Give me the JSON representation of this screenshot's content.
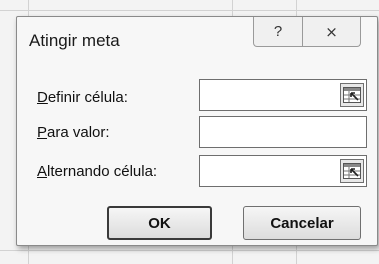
{
  "dialog": {
    "title": "Atingir meta",
    "help_glyph": "?",
    "close_glyph": "⨯"
  },
  "fields": [
    {
      "label_first": "D",
      "label_rest": "efinir célula:",
      "value": ""
    },
    {
      "label_first": "P",
      "label_rest": "ara valor:",
      "value": ""
    },
    {
      "label_first": "A",
      "label_rest": "lternando célula:",
      "value": ""
    }
  ],
  "buttons": {
    "ok": "OK",
    "cancel": "Cancelar"
  },
  "icons": {
    "collapse_dialog": "range-select-icon"
  }
}
